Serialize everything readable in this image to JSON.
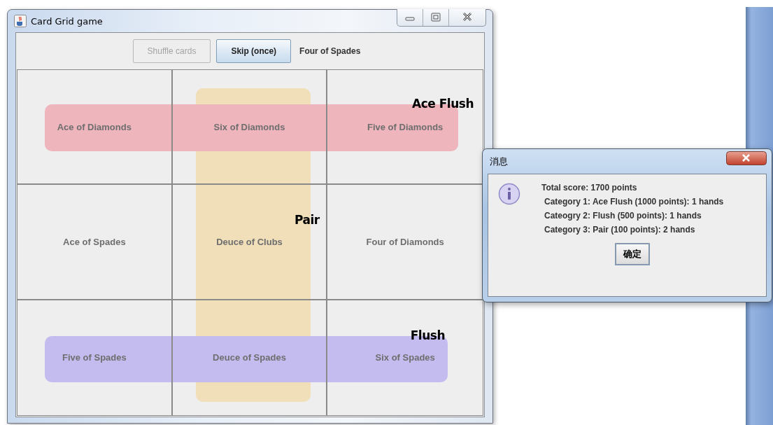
{
  "window": {
    "title": "Card Grid game"
  },
  "toolbar": {
    "buttons": [
      {
        "label": "Shuffle cards",
        "disabled": true
      },
      {
        "label": "Skip (once)",
        "disabled": false
      }
    ],
    "current_card": "Four of Spades"
  },
  "grid": {
    "cells": [
      {
        "label": "Ace of Diamonds",
        "disabled": true,
        "hand": {
          "kind": "row",
          "label": "Ace Flush",
          "color": "#efb5bd"
        }
      },
      {
        "label": "Six of Diamonds",
        "disabled": true
      },
      {
        "label": "Five of Diamonds",
        "disabled": true
      },
      {
        "label": "Ace of Spades",
        "disabled": true
      },
      {
        "label": "Deuce of Clubs",
        "disabled": true,
        "hand": {
          "kind": "column",
          "label": "Pair",
          "color": "#f0dfb9"
        }
      },
      {
        "label": "Four of Diamonds",
        "disabled": true
      },
      {
        "label": "Five of Spades",
        "disabled": true,
        "hand": {
          "kind": "row",
          "label": "Flush",
          "color": "#c4bcef"
        }
      },
      {
        "label": "Deuce of Spades",
        "disabled": true
      },
      {
        "label": "Six of Spades",
        "disabled": true
      }
    ]
  },
  "dialog": {
    "title": "消息",
    "lines": [
      "Total score: 1700 points",
      "Category 1: Ace Flush (1000 points): 1 hands",
      "Cateogry 2: Flush (500 points): 1 hands",
      "Category 3: Pair (100 points): 2 hands"
    ],
    "button": "确定"
  }
}
